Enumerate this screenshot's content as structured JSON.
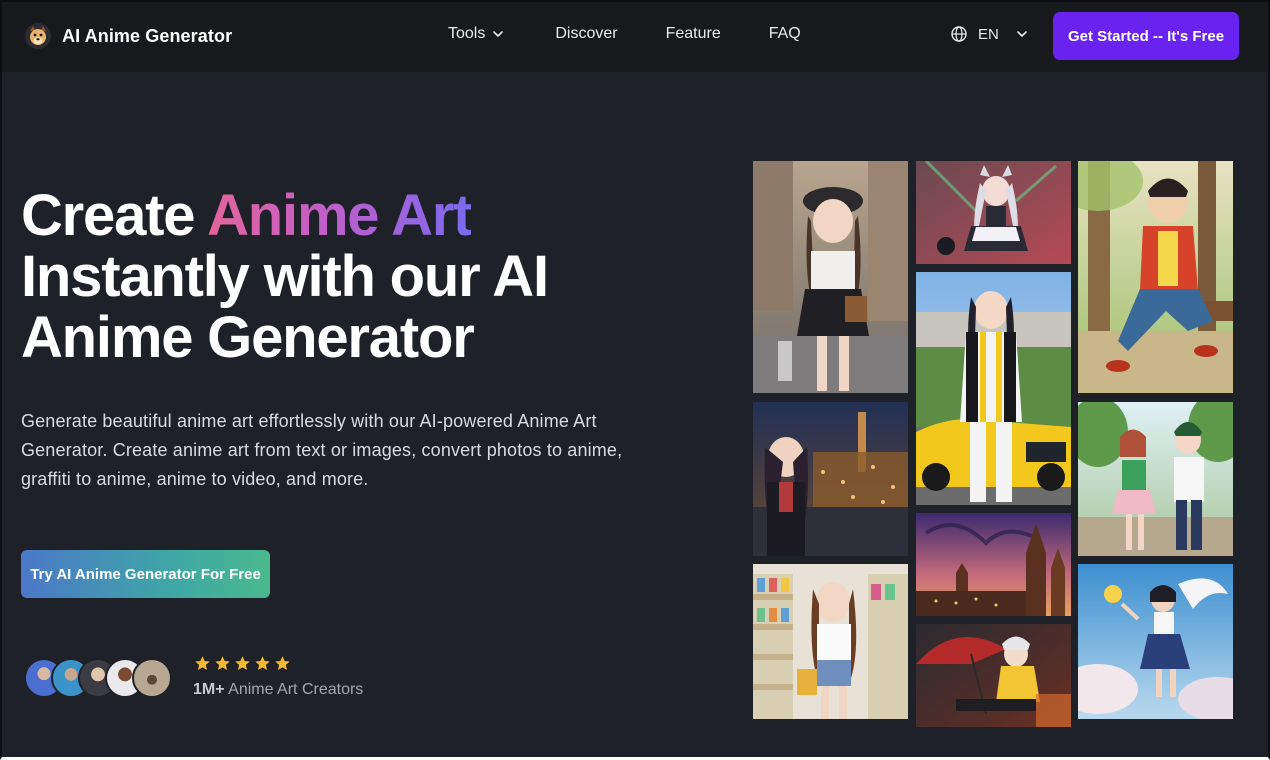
{
  "header": {
    "logo_text": "AI Anime Generator",
    "nav": {
      "tools": "Tools",
      "discover": "Discover",
      "feature": "Feature",
      "faq": "FAQ"
    },
    "language": "EN",
    "cta": "Get Started -- It's Free"
  },
  "hero": {
    "title_part1": "Create ",
    "title_highlight": "Anime Art",
    "title_part2": " Instantly with our AI Anime Generator",
    "description": "Generate beautiful anime art effortlessly with our AI-powered Anime Art Generator. Create anime art from text or images, convert photos to anime, graffiti to anime, anime to video, and more.",
    "cta": "Try AI Anime Generator For Free"
  },
  "social_proof": {
    "stars": 5,
    "count": "1M+",
    "label": " Anime Art Creators"
  },
  "colors": {
    "background": "#1f2128",
    "header": "#18191d",
    "accent_purple": "#6a22ee",
    "star": "#f5b82e"
  },
  "icons": {
    "logo": "dog-face-icon",
    "tools_dropdown": "chevron-down-icon",
    "language": "globe-icon",
    "language_dropdown": "chevron-down-icon",
    "rating": "star-icon"
  }
}
